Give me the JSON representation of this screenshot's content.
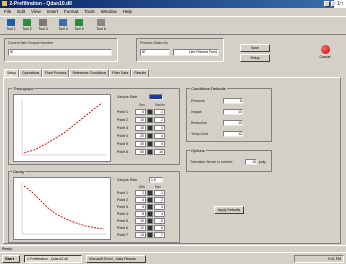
{
  "window": {
    "title": "2-Prefiltration - Qdan10.dll",
    "title_extra": "- 1□"
  },
  "menubar": {
    "items": [
      "File",
      "Edit",
      "View",
      "Insert",
      "Format",
      "Tools",
      "Window",
      "Help"
    ]
  },
  "toolbar": {
    "buttons": [
      "Tool 1",
      "Tool 2",
      "Tool 3",
      "Tool 4",
      "Tool 5",
      "Tool 6"
    ]
  },
  "header": {
    "panel1_label": "Current Item Source Number",
    "panel1_value": "IE",
    "panel2_label": "Process Sales No.",
    "panel2_value": "IE",
    "panel2_value2": "Lieb Filtered Feed",
    "button1": "Save",
    "button2": "Setup",
    "stop_label": "Cancel"
  },
  "tabs": [
    "Setup",
    "Operations",
    "Fluid Process",
    "Reference Conditions",
    "Filter Data",
    "Results"
  ],
  "active_tab": "Setup",
  "group_throughput": {
    "title": "Throughput",
    "data_label": "Sample Rate",
    "data_value": "",
    "col1": "Sec",
    "col2": "Sec/in",
    "rows": [
      {
        "label": "Point 1",
        "v1": "5",
        "v2": "1"
      },
      {
        "label": "Point 2",
        "v1": "10",
        "v2": "2"
      },
      {
        "label": "Point 3",
        "v1": "15",
        "v2": "3"
      },
      {
        "label": "Point 4",
        "v1": "20",
        "v2": "4"
      },
      {
        "label": "Point 5",
        "v1": "30",
        "v2": "5"
      },
      {
        "label": "Point 6",
        "v1": "60",
        "v2": "10"
      }
    ]
  },
  "group_decay": {
    "title": "Decay",
    "data_label": "Sample Rate",
    "data_value": "1.5",
    "col1": "Min",
    "col2": "Sec",
    "rows": [
      {
        "label": "Point 1",
        "v1": "2",
        "v2": "1"
      },
      {
        "label": "Point 2",
        "v1": "4",
        "v2": "2"
      },
      {
        "label": "Point 3",
        "v1": "6",
        "v2": "3"
      },
      {
        "label": "Point 4",
        "v1": "8",
        "v2": "4"
      },
      {
        "label": "Point 5",
        "v1": "10",
        "v2": "5"
      },
      {
        "label": "Point 6",
        "v1": "12",
        "v2": "6"
      },
      {
        "label": "Point 7",
        "v1": "14",
        "v2": "7"
      }
    ]
  },
  "group_conditions": {
    "title": "Conditions Defaults",
    "rows": [
      {
        "label": "Pressure",
        "value": "8"
      },
      {
        "label": "Impact",
        "value": "10"
      },
      {
        "label": "Reduction",
        "value": "10"
      },
      {
        "label": "Temp Limit",
        "value": "12"
      }
    ]
  },
  "group_options": {
    "title": "Options",
    "label": "Transition Sense to exceed",
    "value": "15",
    "unit": "psig"
  },
  "apply_button": "Apply Defaults",
  "statusbar": {
    "text": "Ready"
  },
  "taskbar": {
    "start": "Start",
    "task1": "2-Prefiltration - Qdan10.dll",
    "task2": "Microsoft Excel - Data Results",
    "tray_time": "9:41 PM"
  },
  "colors": {
    "title_bar": "#0a246a",
    "plot_line": "#cc0000",
    "stop_button": "#c00000"
  }
}
